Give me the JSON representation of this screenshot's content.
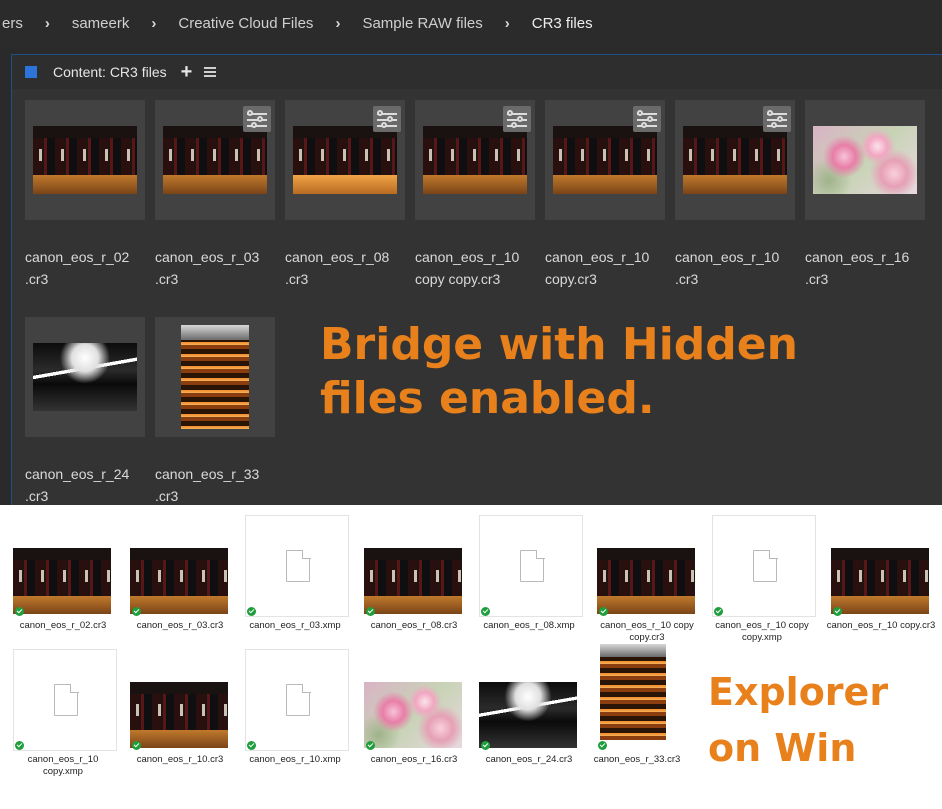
{
  "breadcrumb": {
    "items": [
      "ers",
      "sameerk",
      "Creative Cloud Files",
      "Sample RAW files",
      "CR3 files"
    ],
    "separator": "›"
  },
  "panel": {
    "title": "Content: CR3 files",
    "add_label": "+",
    "menu_icon": "hamburger-menu-icon"
  },
  "bridge_files": [
    {
      "line1": "canon_eos_r_02",
      "line2": ".cr3",
      "image": "wine",
      "settings": false
    },
    {
      "line1": "canon_eos_r_03",
      "line2": ".cr3",
      "image": "wine",
      "settings": true
    },
    {
      "line1": "canon_eos_r_08",
      "line2": ".cr3",
      "image": "wine-bright",
      "settings": true
    },
    {
      "line1": "canon_eos_r_10",
      "line2": "copy copy.cr3",
      "image": "wine",
      "settings": true
    },
    {
      "line1": "canon_eos_r_10",
      "line2": "copy.cr3",
      "image": "wine",
      "settings": true
    },
    {
      "line1": "canon_eos_r_10",
      "line2": ".cr3",
      "image": "wine",
      "settings": true
    },
    {
      "line1": "canon_eos_r_16",
      "line2": ".cr3",
      "image": "flower",
      "settings": false
    },
    {
      "line1": "canon_eos_r_24",
      "line2": ".cr3",
      "image": "atrium",
      "settings": false
    },
    {
      "line1": "canon_eos_r_33",
      "line2": ".cr3",
      "image": "stairs",
      "settings": false
    }
  ],
  "overlays": {
    "bridge_line1": "Bridge with Hidden",
    "bridge_line2": "files enabled.",
    "explorer_line1": "Explorer",
    "explorer_line2": "on Win"
  },
  "explorer_files": [
    {
      "name": "canon_eos_r_02.cr3",
      "kind": "wine"
    },
    {
      "name": "canon_eos_r_03.cr3",
      "kind": "wine"
    },
    {
      "name": "canon_eos_r_03.xmp",
      "kind": "doc"
    },
    {
      "name": "canon_eos_r_08.cr3",
      "kind": "wine"
    },
    {
      "name": "canon_eos_r_08.xmp",
      "kind": "doc"
    },
    {
      "name": "canon_eos_r_10 copy copy.cr3",
      "kind": "wine"
    },
    {
      "name": "canon_eos_r_10 copy copy.xmp",
      "kind": "doc"
    },
    {
      "name": "canon_eos_r_10 copy.cr3",
      "kind": "wine"
    },
    {
      "name": "canon_eos_r_10 copy.xmp",
      "kind": "doc"
    },
    {
      "name": "canon_eos_r_10.cr3",
      "kind": "wine"
    },
    {
      "name": "canon_eos_r_10.xmp",
      "kind": "doc"
    },
    {
      "name": "canon_eos_r_16.cr3",
      "kind": "flower"
    },
    {
      "name": "canon_eos_r_24.cr3",
      "kind": "atrium"
    },
    {
      "name": "canon_eos_r_33.cr3",
      "kind": "stairs"
    }
  ],
  "colors": {
    "accent": "#2d74da",
    "overlay_text": "#e8801b",
    "sync_check": "#1e9e3c",
    "bridge_bg": "#333333"
  }
}
